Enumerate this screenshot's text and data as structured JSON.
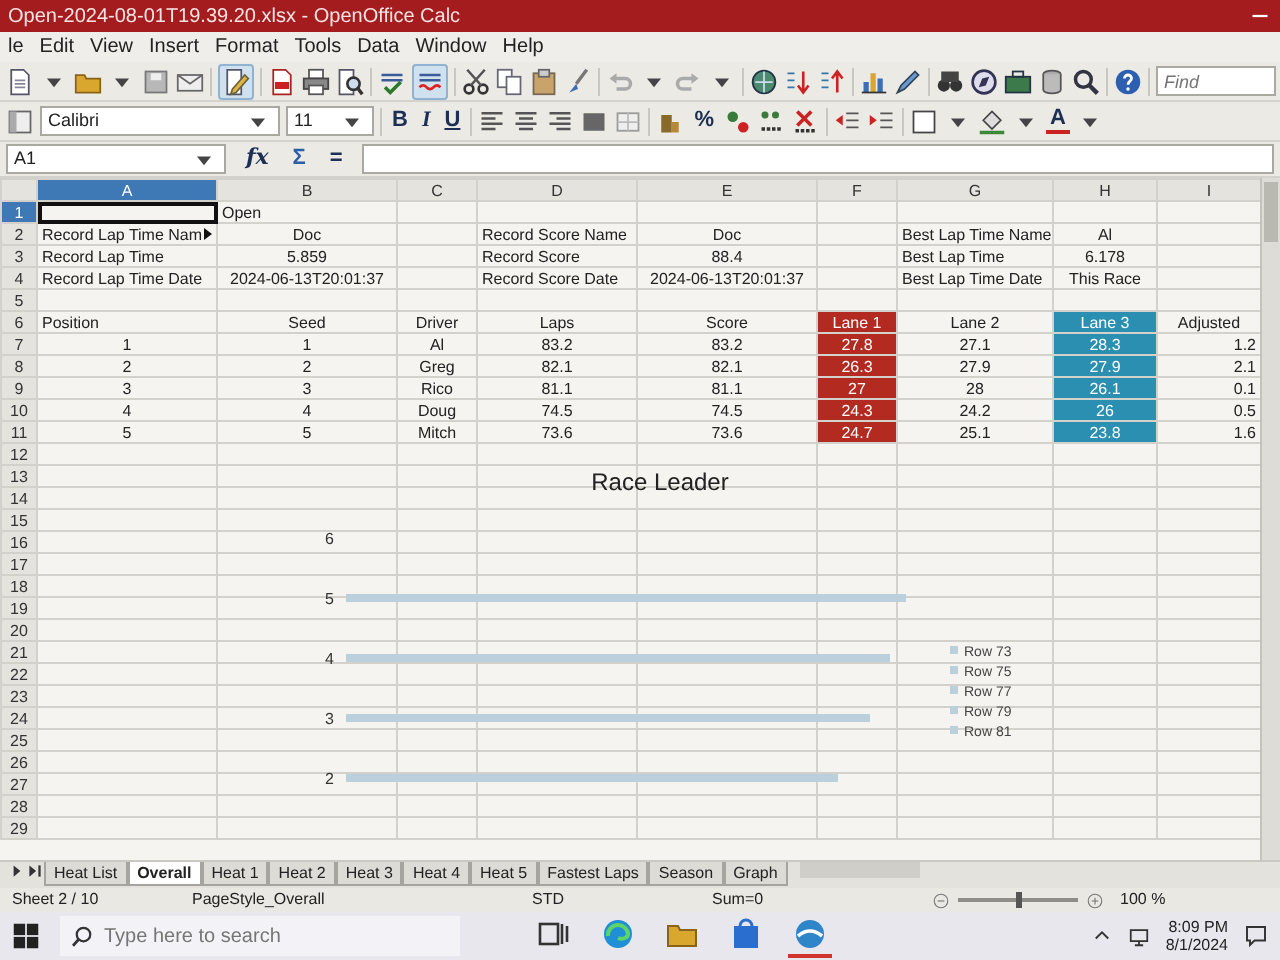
{
  "window": {
    "title": "Open-2024-08-01T19.39.20.xlsx - OpenOffice Calc"
  },
  "menu": [
    "le",
    "Edit",
    "View",
    "Insert",
    "Format",
    "Tools",
    "Data",
    "Window",
    "Help"
  ],
  "toolbar": {
    "edit_mode_pressed": true,
    "autospellcheck_pressed": true,
    "find_placeholder": "Find"
  },
  "format_bar": {
    "font_name": "Calibri",
    "font_size": "11",
    "bold": "B",
    "italic": "I",
    "underline": "U",
    "percent": "%",
    "font_color": "A"
  },
  "formula_bar": {
    "name_box": "A1",
    "function_wizard": "fx",
    "sum": "Σ",
    "equals": "="
  },
  "columns": [
    {
      "label": "A",
      "selected": true
    },
    {
      "label": "B",
      "selected": false
    },
    {
      "label": "C",
      "selected": false
    },
    {
      "label": "D",
      "selected": false
    },
    {
      "label": "E",
      "selected": false
    },
    {
      "label": "F",
      "selected": false
    },
    {
      "label": "G",
      "selected": false
    },
    {
      "label": "H",
      "selected": false
    },
    {
      "label": "I",
      "selected": false
    }
  ],
  "rows": [
    {
      "number": "1",
      "selected": true,
      "cells": [
        null,
        {
          "text": "Open",
          "kind": "label"
        },
        null,
        null,
        null,
        null,
        null,
        null,
        null
      ]
    },
    {
      "number": "2",
      "selected": false,
      "cells": [
        {
          "text": "Record Lap Time Nam",
          "kind": "label",
          "overflow": true
        },
        {
          "text": "Doc",
          "kind": "value"
        },
        null,
        {
          "text": "Record Score Name",
          "kind": "label"
        },
        {
          "text": "Doc",
          "kind": "value"
        },
        null,
        {
          "text": "Best Lap Time Name",
          "kind": "label"
        },
        {
          "text": "Al",
          "kind": "value"
        },
        null
      ]
    },
    {
      "number": "3",
      "selected": false,
      "cells": [
        {
          "text": "Record Lap Time",
          "kind": "label"
        },
        {
          "text": "5.859",
          "kind": "value"
        },
        null,
        {
          "text": "Record Score",
          "kind": "label"
        },
        {
          "text": "88.4",
          "kind": "value"
        },
        null,
        {
          "text": "Best Lap Time",
          "kind": "label"
        },
        {
          "text": "6.178",
          "kind": "value"
        },
        null
      ]
    },
    {
      "number": "4",
      "selected": false,
      "cells": [
        {
          "text": "Record Lap Time Date",
          "kind": "label"
        },
        {
          "text": "2024-06-13T20:01:37",
          "kind": "value"
        },
        null,
        {
          "text": "Record Score Date",
          "kind": "label"
        },
        {
          "text": "2024-06-13T20:01:37",
          "kind": "value"
        },
        null,
        {
          "text": "Best Lap Time Date",
          "kind": "label"
        },
        {
          "text": "This Race",
          "kind": "value"
        },
        null
      ]
    },
    {
      "number": "5",
      "selected": false
    },
    {
      "number": "6",
      "selected": false,
      "cells": [
        {
          "text": "Position",
          "kind": "label"
        },
        {
          "text": "Seed",
          "kind": "value"
        },
        {
          "text": "Driver",
          "kind": "value"
        },
        {
          "text": "Laps",
          "kind": "value"
        },
        {
          "text": "Score",
          "kind": "value"
        },
        {
          "text": "Lane 1",
          "kind": "value",
          "color": "#b32a21"
        },
        {
          "text": "Lane 2",
          "kind": "value"
        },
        {
          "text": "Lane 3",
          "kind": "value",
          "color": "#2a8fb0"
        },
        {
          "text": "Adjusted",
          "kind": "value"
        }
      ]
    },
    {
      "number": "7",
      "selected": false,
      "cells": [
        {
          "text": "1",
          "kind": "value"
        },
        {
          "text": "1",
          "kind": "value"
        },
        {
          "text": "Al",
          "kind": "value"
        },
        {
          "text": "83.2",
          "kind": "value"
        },
        {
          "text": "83.2",
          "kind": "value"
        },
        {
          "text": "27.8",
          "kind": "value",
          "color": "#b32a21"
        },
        {
          "text": "27.1",
          "kind": "value"
        },
        {
          "text": "28.3",
          "kind": "value",
          "color": "#2a8fb0"
        },
        {
          "text": "1.2",
          "kind": "number"
        }
      ]
    },
    {
      "number": "8",
      "selected": false,
      "cells": [
        {
          "text": "2",
          "kind": "value"
        },
        {
          "text": "2",
          "kind": "value"
        },
        {
          "text": "Greg",
          "kind": "value"
        },
        {
          "text": "82.1",
          "kind": "value"
        },
        {
          "text": "82.1",
          "kind": "value"
        },
        {
          "text": "26.3",
          "kind": "value",
          "color": "#b32a21"
        },
        {
          "text": "27.9",
          "kind": "value"
        },
        {
          "text": "27.9",
          "kind": "value",
          "color": "#2a8fb0"
        },
        {
          "text": "2.1",
          "kind": "number"
        }
      ]
    },
    {
      "number": "9",
      "selected": false,
      "cells": [
        {
          "text": "3",
          "kind": "value"
        },
        {
          "text": "3",
          "kind": "value"
        },
        {
          "text": "Rico",
          "kind": "value"
        },
        {
          "text": "81.1",
          "kind": "value"
        },
        {
          "text": "81.1",
          "kind": "value"
        },
        {
          "text": "27",
          "kind": "value",
          "color": "#b32a21"
        },
        {
          "text": "28",
          "kind": "value"
        },
        {
          "text": "26.1",
          "kind": "value",
          "color": "#2a8fb0"
        },
        {
          "text": "0.1",
          "kind": "number"
        }
      ]
    },
    {
      "number": "10",
      "selected": false,
      "cells": [
        {
          "text": "4",
          "kind": "value"
        },
        {
          "text": "4",
          "kind": "value"
        },
        {
          "text": "Doug",
          "kind": "value"
        },
        {
          "text": "74.5",
          "kind": "value"
        },
        {
          "text": "74.5",
          "kind": "value"
        },
        {
          "text": "24.3",
          "kind": "value",
          "color": "#b32a21"
        },
        {
          "text": "24.2",
          "kind": "value"
        },
        {
          "text": "26",
          "kind": "value",
          "color": "#2a8fb0"
        },
        {
          "text": "0.5",
          "kind": "number"
        }
      ]
    },
    {
      "number": "11",
      "selected": false,
      "cells": [
        {
          "text": "5",
          "kind": "value"
        },
        {
          "text": "5",
          "kind": "value"
        },
        {
          "text": "Mitch",
          "kind": "value"
        },
        {
          "text": "73.6",
          "kind": "value"
        },
        {
          "text": "73.6",
          "kind": "value"
        },
        {
          "text": "24.7",
          "kind": "value",
          "color": "#b32a21"
        },
        {
          "text": "25.1",
          "kind": "value"
        },
        {
          "text": "23.8",
          "kind": "value",
          "color": "#2a8fb0"
        },
        {
          "text": "1.6",
          "kind": "number"
        }
      ]
    },
    {
      "number": "12",
      "selected": false
    },
    {
      "number": "13",
      "selected": false
    },
    {
      "number": "14",
      "selected": false
    },
    {
      "number": "15",
      "selected": false
    },
    {
      "number": "16",
      "selected": false
    },
    {
      "number": "17",
      "selected": false
    },
    {
      "number": "18",
      "selected": false
    },
    {
      "number": "19",
      "selected": false
    },
    {
      "number": "20",
      "selected": false
    },
    {
      "number": "21",
      "selected": false
    },
    {
      "number": "22",
      "selected": false
    },
    {
      "number": "23",
      "selected": false
    },
    {
      "number": "24",
      "selected": false
    },
    {
      "number": "25",
      "selected": false
    },
    {
      "number": "26",
      "selected": false
    },
    {
      "number": "27",
      "selected": false
    },
    {
      "number": "28",
      "selected": false
    },
    {
      "number": "29",
      "selected": false
    }
  ],
  "chart": {
    "title": "Race Leader",
    "y_labels": [
      "6",
      "5",
      "4",
      "3",
      "2"
    ],
    "legend": [
      "Row 73",
      "Row 75",
      "Row 77",
      "Row 79",
      "Row 81"
    ]
  },
  "sheet_tabs": [
    {
      "label": "Heat List",
      "selected": false
    },
    {
      "label": "Overall",
      "selected": true
    },
    {
      "label": "Heat 1",
      "selected": false
    },
    {
      "label": "Heat 2",
      "selected": false
    },
    {
      "label": "Heat 3",
      "selected": false
    },
    {
      "label": "Heat 4",
      "selected": false
    },
    {
      "label": "Heat 5",
      "selected": false
    },
    {
      "label": "Fastest Laps",
      "selected": false
    },
    {
      "label": "Season",
      "selected": false
    },
    {
      "label": "Graph",
      "selected": false
    }
  ],
  "status_bar": {
    "sheet": "Sheet 2 / 10",
    "page_style": "PageStyle_Overall",
    "mode": "STD",
    "sum": "Sum=0",
    "zoom": {
      "level": 0.5
    },
    "zoom_reading": "100 %"
  },
  "taskbar": {
    "search_placeholder": "Type here to search",
    "apps": [
      {
        "kind": "task-view",
        "active": false
      },
      {
        "kind": "browser",
        "active": false
      },
      {
        "kind": "folder",
        "active": false
      },
      {
        "kind": "store",
        "active": false
      },
      {
        "kind": "office",
        "active": true
      }
    ],
    "time": "8:09 PM",
    "date": "8/1/2024"
  }
}
